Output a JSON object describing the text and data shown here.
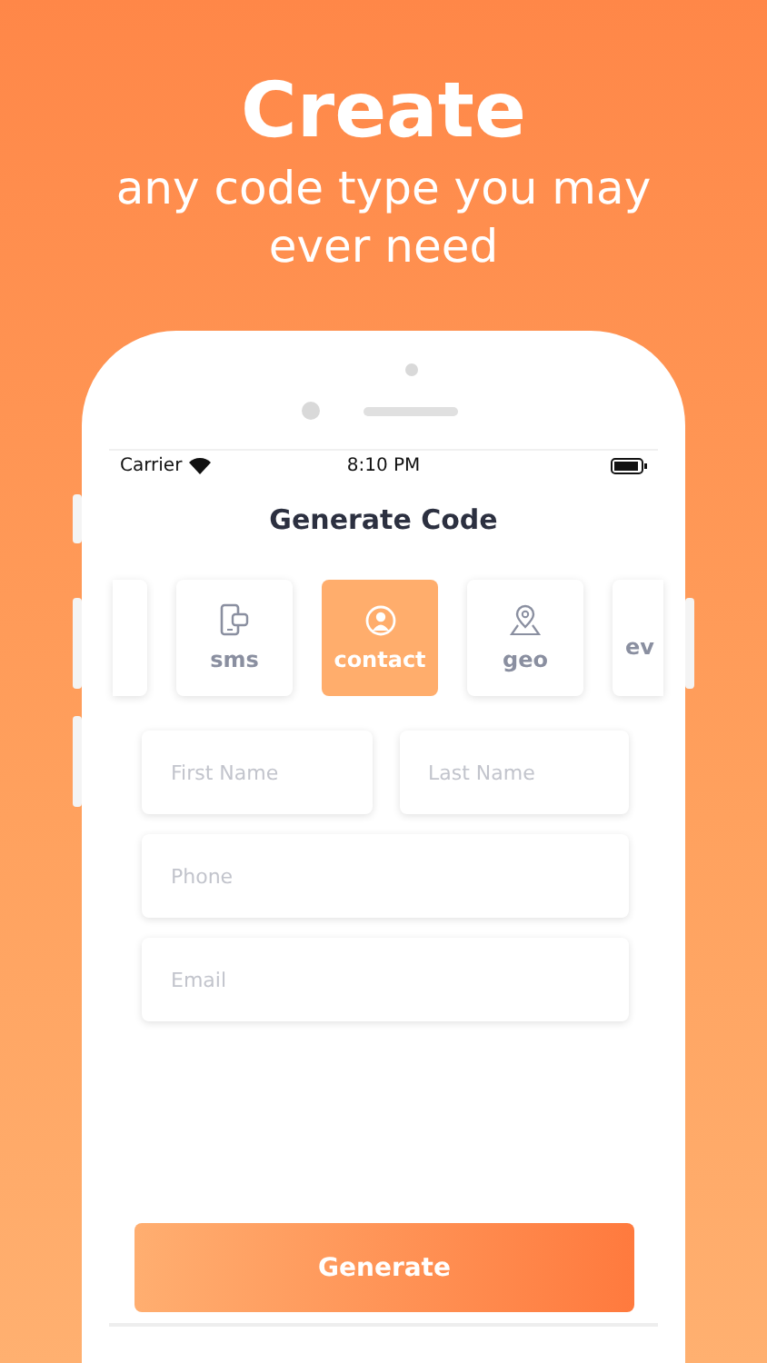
{
  "headline": {
    "title": "Create",
    "subtitle": "any code type you may ever need"
  },
  "status_bar": {
    "carrier": "Carrier",
    "time": "8:10 PM"
  },
  "screen_title": "Generate Code",
  "code_types": [
    {
      "kind": "partial",
      "selected": false
    },
    {
      "kind": "sms",
      "label": "sms",
      "selected": false
    },
    {
      "kind": "contact",
      "label": "contact",
      "selected": true
    },
    {
      "kind": "geo",
      "label": "geo",
      "selected": false
    },
    {
      "kind": "edge",
      "label": "ev",
      "selected": false
    }
  ],
  "fields": [
    {
      "placeholder": "First Name"
    },
    {
      "placeholder": "Last Name"
    },
    {
      "placeholder": "Phone"
    },
    {
      "placeholder": "Email"
    }
  ],
  "primary_button": "Generate"
}
